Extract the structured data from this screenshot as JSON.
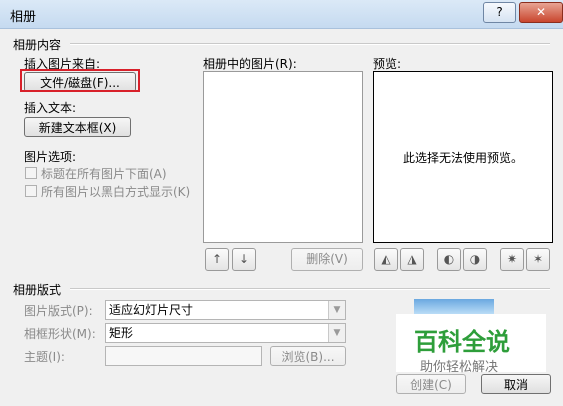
{
  "window": {
    "title": "相册",
    "help_label": "?",
    "close_label": "✕"
  },
  "album_content": {
    "group_title": "相册内容",
    "insert_from_label": "插入图片来自:",
    "file_disk_button": "文件/磁盘(F)...",
    "insert_text_label": "插入文本:",
    "new_textbox_button": "新建文本框(X)",
    "picture_options_label": "图片选项:",
    "option_captions": "标题在所有图片下面(A)",
    "option_bw": "所有图片以黑白方式显示(K)",
    "pictures_in_album_label": "相册中的图片(R):",
    "preview_label": "预览:",
    "preview_message": "此选择无法使用预览。",
    "move_up_icon": "arrow-up-icon",
    "move_down_icon": "arrow-down-icon",
    "remove_button": "删除(V)",
    "rotate_icons": [
      "rotate-left-icon",
      "rotate-right-icon",
      "contrast-up-icon",
      "contrast-down-icon",
      "brightness-up-icon",
      "brightness-down-icon"
    ]
  },
  "album_layout": {
    "group_title": "相册版式",
    "picture_layout_label": "图片版式(P):",
    "picture_layout_value": "适应幻灯片尺寸",
    "frame_shape_label": "相框形状(M):",
    "frame_shape_value": "矩形",
    "theme_label": "主题(I):",
    "theme_value": "",
    "browse_button": "浏览(B)..."
  },
  "footer": {
    "create_button": "创建(C)",
    "cancel_button": "取消"
  },
  "watermark": {
    "main": "百科全说",
    "sub": "助你轻松解决"
  },
  "colors": {
    "highlight": "#d8202a",
    "watermark_green": "#2e9e3a"
  }
}
